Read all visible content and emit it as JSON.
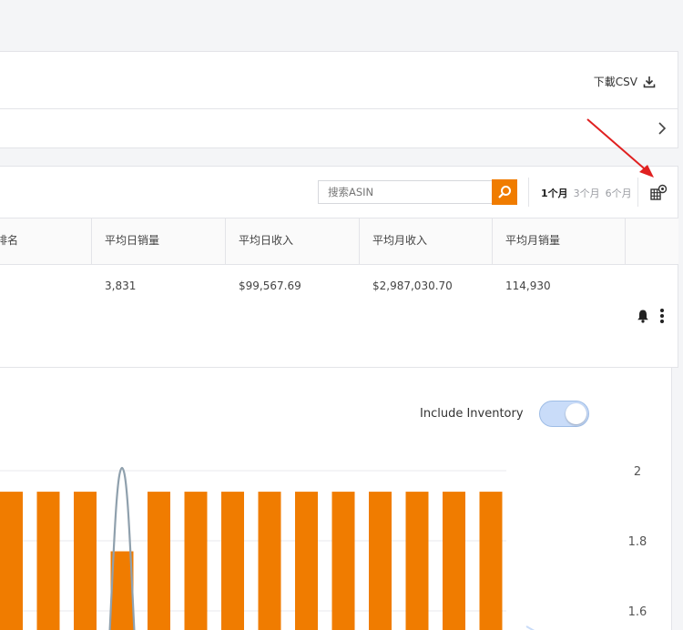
{
  "header": {
    "download_label": "下載CSV"
  },
  "toolbar": {
    "search_placeholder": "搜索ASIN",
    "ranges": [
      "1个月",
      "3个月",
      "6个月"
    ],
    "active_range": 0
  },
  "table": {
    "columns": [
      "排名",
      "平均日销量",
      "平均日收入",
      "平均月收入",
      "平均月销量"
    ],
    "row": [
      "3,831",
      "$99,567.69",
      "$2,987,030.70",
      "114,930"
    ]
  },
  "chart": {
    "include_inventory_label": "Include Inventory",
    "include_inventory_on": true
  },
  "colors": {
    "accent": "#f07c00",
    "line": "#8fa0ad",
    "annotation_arrow": "#e02020"
  },
  "icons": [
    "download-icon",
    "chevron-right-icon",
    "search-icon",
    "grid-settings-icon",
    "bell-icon",
    "more-vertical-icon"
  ],
  "chart_data": {
    "type": "bar",
    "title": "",
    "y_ticks": [
      2,
      1.8,
      1.6
    ],
    "y_tick_labels": [
      "2",
      "1.8",
      "1.6"
    ],
    "bar_values": [
      1.94,
      1.94,
      1.94,
      1.77,
      1.94,
      1.94,
      1.94,
      1.94,
      1.94,
      1.94,
      1.94,
      1.94,
      1.94,
      1.94
    ],
    "line_series": {
      "peak_index": 3,
      "peak_value": 2.0,
      "base_value": 1.5
    },
    "ylim": [
      1.5,
      2.0
    ],
    "grid": true
  }
}
